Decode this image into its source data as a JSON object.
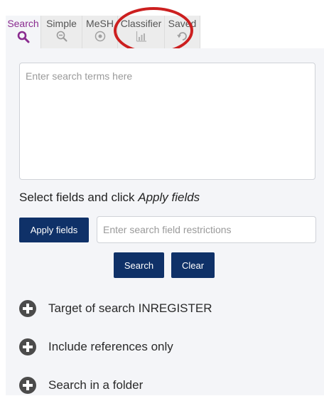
{
  "tabs": [
    {
      "label": "Search",
      "icon": "search-icon"
    },
    {
      "label": "Simple",
      "icon": "zoom-out-icon"
    },
    {
      "label": "MeSH",
      "icon": "mesh-icon"
    },
    {
      "label": "Classifier",
      "icon": "bar-chart-icon"
    },
    {
      "label": "Saved",
      "icon": "history-icon"
    }
  ],
  "active_tab": "Search",
  "search": {
    "placeholder": "Enter search terms here"
  },
  "fields": {
    "instruction_text": "Select fields and click ",
    "instruction_emphasis": "Apply fields",
    "apply_label": "Apply fields",
    "placeholder": "Enter search field restrictions"
  },
  "actions": {
    "search_label": "Search",
    "clear_label": "Clear"
  },
  "options": [
    {
      "label": "Target of search INREGISTER",
      "icon": "plus-circle-icon"
    },
    {
      "label": "Include references only",
      "icon": "plus-circle-icon"
    },
    {
      "label": "Search in a folder",
      "icon": "plus-circle-icon"
    }
  ],
  "colors": {
    "accent_active_tab": "#8a2b8f",
    "button_primary": "#0f3168",
    "annotation_red": "#cc1f1f",
    "panel_bg": "#f4f5f8"
  }
}
